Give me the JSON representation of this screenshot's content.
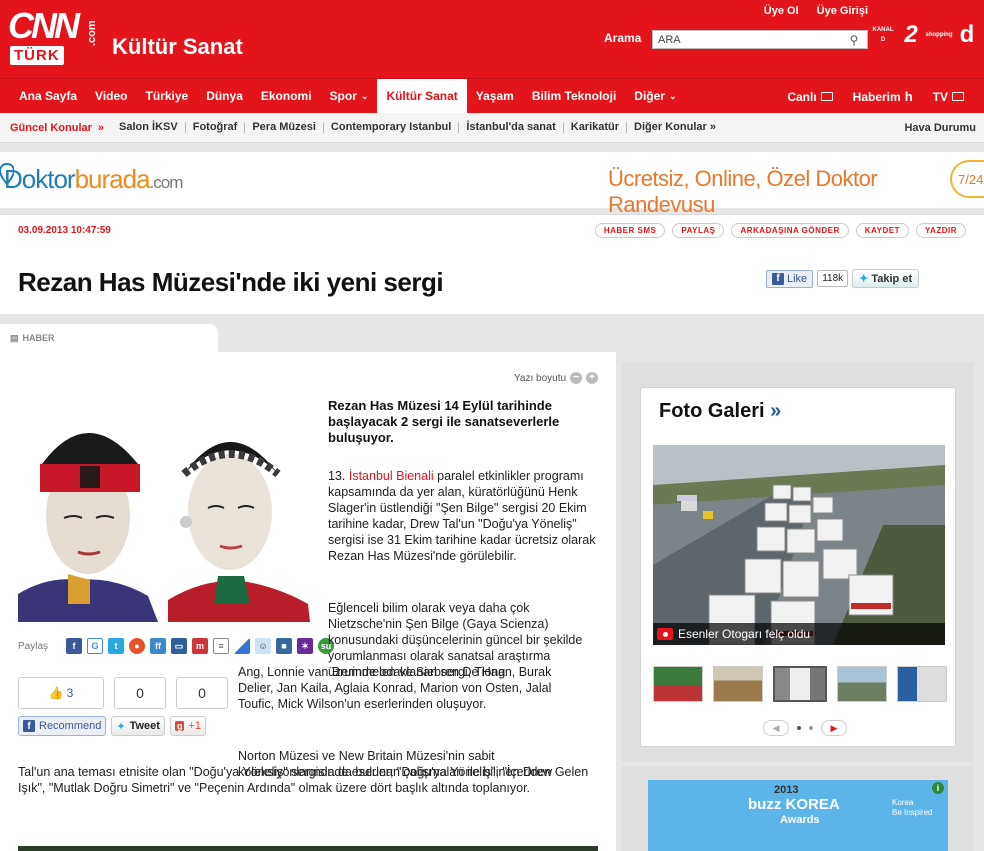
{
  "header": {
    "logo_main": "CNN",
    "logo_sub": "TÜRK",
    "logo_com": ".com",
    "section_title": "Kültür Sanat",
    "top_links": [
      "Üye Ol",
      "Üye Girişi"
    ],
    "search_label": "Arama",
    "search_value": "ARA",
    "channels": [
      "KANAL D",
      "2",
      "shopping",
      "d"
    ]
  },
  "nav": {
    "items": [
      "Ana Sayfa",
      "Video",
      "Türkiye",
      "Dünya",
      "Ekonomi",
      "Spor",
      "Kültür Sanat",
      "Yaşam",
      "Bilim Teknoloji",
      "Diğer"
    ],
    "active": "Kültür Sanat",
    "right_items": [
      "Canlı",
      "Haberim",
      "TV"
    ]
  },
  "subnav": {
    "lead": "Güncel Konular",
    "lead_arrow": "»",
    "items": [
      "Salon İKSV",
      "Fotoğraf",
      "Pera Müzesi",
      "Contemporary Istanbul",
      "İstanbul'da sanat",
      "Karikatür",
      "Diğer Konular »"
    ],
    "right": "Hava Durumu"
  },
  "banner": {
    "brand_a": "Doktor",
    "brand_b": "burada",
    "brand_c": ".com",
    "slogan": "Ücretsiz, Online, Özel Doktor Randevusu",
    "badge": "7/24"
  },
  "article": {
    "date": "03.09.2013 10:47:59",
    "actions": [
      "HABER SMS",
      "PAYLAŞ",
      "ARKADAŞINA GÖNDER",
      "KAYDET",
      "YAZDIR"
    ],
    "title": "Rezan Has Müzesi'nde iki yeni sergi",
    "fb_like": "Like",
    "fb_count": "118k",
    "tw_follow": "Takip et",
    "tab": "HABER",
    "font_size_label": "Yazı boyutu",
    "lead": "Rezan Has Müzesi 14 Eylül tarihinde başlayacak 2 sergi ile sanatseverlerle buluşuyor.",
    "p1_pre": "13. ",
    "p1_link": "İstanbul Bienali",
    "p1_post": " paralel etkinlikler programı kapsamında da yer alan, küratörlüğünü Henk Slager'in üstlendiği \"Şen Bilge\" sergisi 20 Ekim tarihine kadar, Drew Tal'un \"Doğu'ya Yöneliş\" sergisi ise 31 Ekim tarihine kadar ücretsiz olarak Rezan Has Müzesi'nde görülebilir.",
    "p2": "Eğlenceli bilim olarak veya daha çok Nietzsche'nin Şen Bilge (Gaya Scienza) konusundaki düşüncelerinin güncel bir şekilde yorumlanması olarak sanatsal araştırma üzerinde odaklanan sergi, Tiong",
    "p2b": "Ang, Lonnie van Brummelen ve Siebren De Haan, Burak Delier, Jan Kaila, Aglaia Konrad, Marion von Osten, Jalal Toufic, Mick Wilson'un eserlerinden oluşuyor.",
    "p3a": "Norton Müzesi ve New Britain Müzesi'nin sabit koleksiyonlarında da bulunan çalışmaları ile bilinen Drew",
    "p3b": "Tal'un ana teması etnisite olan \"Doğu'ya Yöneliş\" sergisinde eserler; \"Doğu'ya Yöneliş\", \"İçeriden Gelen Işık\", \"Mutlak Doğru Simetri\" ve \"Peçenin Ardında\" olmak üzere  dört başlık altında toplanıyor."
  },
  "share": {
    "label": "Paylaş",
    "counts": [
      "3",
      "0",
      "0"
    ],
    "recommend": "Recommend",
    "tweet": "Tweet",
    "gplus": "+1"
  },
  "gallery": {
    "title": "Foto Galeri",
    "arrow": "»",
    "caption": "Esenler Otogarı felç oldu"
  },
  "ad2": {
    "year": "2013",
    "name": "buzz KOREA",
    "awards": "Awards",
    "side_1": "Korea",
    "side_2": "Be Inspired"
  },
  "colors": {
    "brand_red": "#e4141b",
    "link_blue": "#1d5fa6"
  }
}
